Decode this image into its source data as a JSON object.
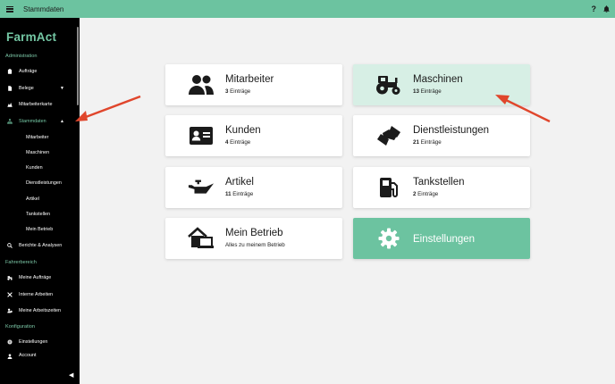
{
  "topbar": {
    "title": "Stammdaten",
    "help": "?",
    "menu_icon": "hamburger-icon",
    "bell_icon": "bell-icon"
  },
  "sidebar": {
    "brand": "FarmAct",
    "sections": [
      {
        "label": "Administration"
      },
      {
        "label": "Fahrerbereich"
      },
      {
        "label": "Konfiguration"
      }
    ],
    "items": {
      "auftraege": {
        "label": "Aufträge",
        "icon": "clipboard-icon"
      },
      "belege": {
        "label": "Belege",
        "icon": "document-icon",
        "caret": "▼"
      },
      "mitarbeiterkarte": {
        "label": "Mitarbeiterkarte",
        "icon": "map-icon"
      },
      "stammdaten": {
        "label": "Stammdaten",
        "icon": "sitemap-icon",
        "caret": "▲"
      },
      "berichte": {
        "label": "Berichte & Analysen",
        "icon": "search-chart-icon"
      },
      "meine_auftraege": {
        "label": "Meine Aufträge",
        "icon": "tractor-icon"
      },
      "interne_arbeiten": {
        "label": "Interne Arbeiten",
        "icon": "tools-icon"
      },
      "arbeitszeiten": {
        "label": "Meine Arbeitszeiten",
        "icon": "user-clock-icon"
      },
      "einstellungen": {
        "label": "Einstellungen",
        "icon": "gear-icon"
      },
      "account": {
        "label": "Account",
        "icon": "user-icon"
      }
    },
    "sub_items": [
      "Mitarbeiter",
      "Maschinen",
      "Kunden",
      "Dienstleistungen",
      "Artikel",
      "Tankstellen",
      "Mein Betrieb"
    ],
    "collapse": "◀"
  },
  "cards": {
    "mitarbeiter": {
      "title": "Mitarbeiter",
      "count": "3",
      "suffix": " Einträge",
      "icon": "users-icon"
    },
    "maschinen": {
      "title": "Maschinen",
      "count": "13",
      "suffix": " Einträge",
      "icon": "tractor-icon"
    },
    "kunden": {
      "title": "Kunden",
      "count": "4",
      "suffix": " Einträge",
      "icon": "id-card-icon"
    },
    "dienstleistungen": {
      "title": "Dienstleistungen",
      "count": "21",
      "suffix": " Einträge",
      "icon": "handshake-icon"
    },
    "artikel": {
      "title": "Artikel",
      "count": "11",
      "suffix": " Einträge",
      "icon": "oil-can-icon"
    },
    "tankstellen": {
      "title": "Tankstellen",
      "count": "2",
      "suffix": " Einträge",
      "icon": "gas-pump-icon"
    },
    "mein_betrieb": {
      "title": "Mein Betrieb",
      "sub": "Alles zu meinem Betrieb",
      "icon": "farm-house-icon"
    },
    "einstellungen": {
      "title": "Einstellungen",
      "icon": "gear-icon"
    }
  },
  "colors": {
    "brand": "#6cc3a0",
    "highlight": "#d7efe5",
    "sidebar": "#000000",
    "annotation_arrow": "#e0462c"
  }
}
